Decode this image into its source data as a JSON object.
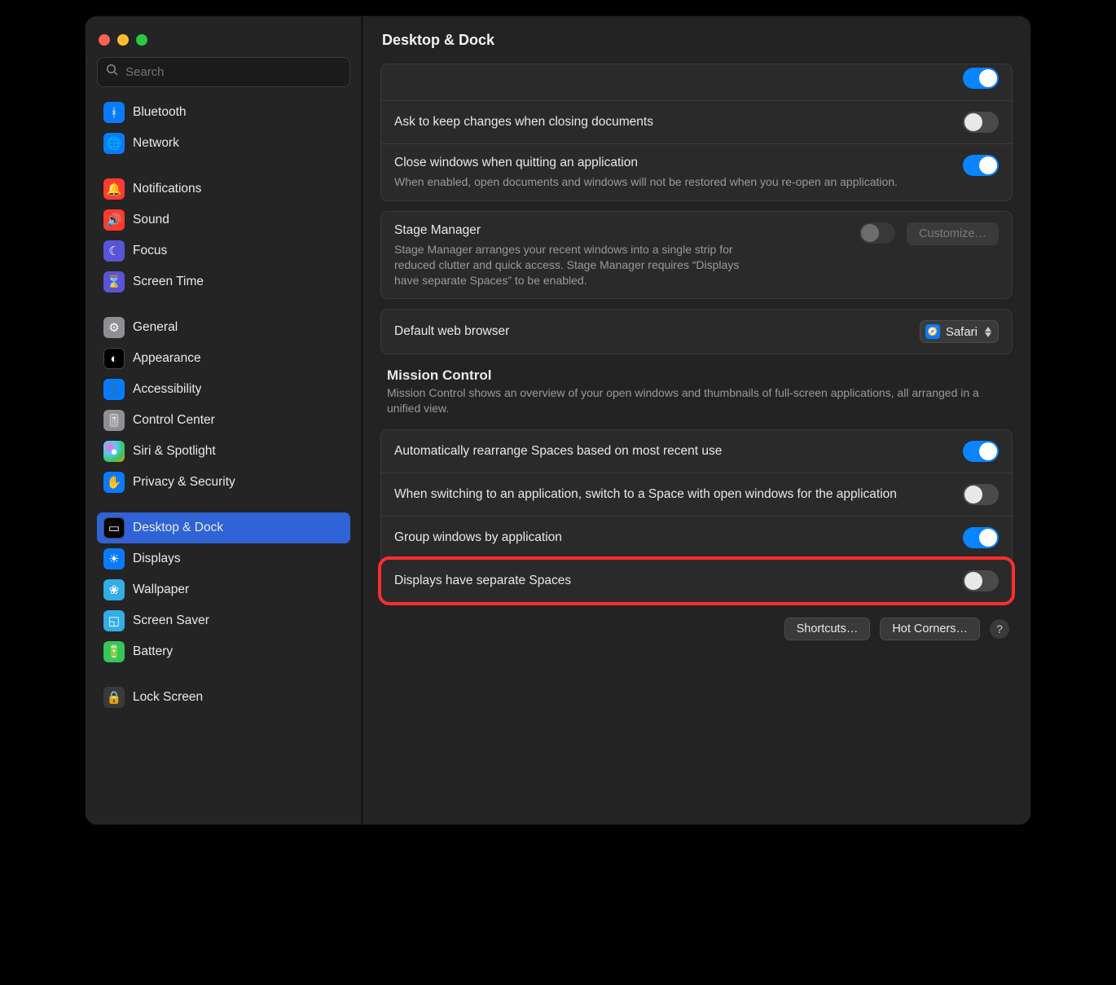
{
  "window": {
    "title": "Desktop & Dock"
  },
  "search": {
    "placeholder": "Search"
  },
  "sidebar": {
    "groups": [
      {
        "items": [
          {
            "label": "Bluetooth",
            "icon": "bluetooth",
            "bg": "bg-blue"
          },
          {
            "label": "Network",
            "icon": "globe",
            "bg": "bg-blue"
          }
        ]
      },
      {
        "items": [
          {
            "label": "Notifications",
            "icon": "bell",
            "bg": "bg-red"
          },
          {
            "label": "Sound",
            "icon": "speaker",
            "bg": "bg-red"
          },
          {
            "label": "Focus",
            "icon": "moon",
            "bg": "bg-purple"
          },
          {
            "label": "Screen Time",
            "icon": "hourglass",
            "bg": "bg-purple"
          }
        ]
      },
      {
        "items": [
          {
            "label": "General",
            "icon": "gear",
            "bg": "bg-gray"
          },
          {
            "label": "Appearance",
            "icon": "contrast",
            "bg": "bg-black"
          },
          {
            "label": "Accessibility",
            "icon": "person",
            "bg": "bg-blue"
          },
          {
            "label": "Control Center",
            "icon": "switches",
            "bg": "bg-gray"
          },
          {
            "label": "Siri & Spotlight",
            "icon": "siri",
            "bg": "bg-siri"
          },
          {
            "label": "Privacy & Security",
            "icon": "hand",
            "bg": "bg-blue"
          }
        ]
      },
      {
        "items": [
          {
            "label": "Desktop & Dock",
            "icon": "dock",
            "bg": "bg-black",
            "selected": true
          },
          {
            "label": "Displays",
            "icon": "brightness",
            "bg": "bg-blue"
          },
          {
            "label": "Wallpaper",
            "icon": "flower",
            "bg": "bg-cyan"
          },
          {
            "label": "Screen Saver",
            "icon": "screensaver",
            "bg": "bg-cyan"
          },
          {
            "label": "Battery",
            "icon": "battery",
            "bg": "bg-green"
          }
        ]
      },
      {
        "items": [
          {
            "label": "Lock Screen",
            "icon": "lock",
            "bg": "bg-darkgray"
          }
        ]
      }
    ]
  },
  "settings": {
    "askKeepChanges": {
      "label": "Ask to keep changes when closing documents",
      "on": false
    },
    "closeWindows": {
      "label": "Close windows when quitting an application",
      "desc": "When enabled, open documents and windows will not be restored when you re-open an application.",
      "on": true
    },
    "stageManager": {
      "label": "Stage Manager",
      "desc": "Stage Manager arranges your recent windows into a single strip for reduced clutter and quick access. Stage Manager requires “Displays have separate Spaces” to be enabled.",
      "on": false,
      "disabled": true,
      "button": "Customize…"
    },
    "defaultBrowser": {
      "label": "Default web browser",
      "value": "Safari"
    },
    "missionControl": {
      "title": "Mission Control",
      "desc": "Mission Control shows an overview of your open windows and thumbnails of full-screen applications, all arranged in a unified view."
    },
    "autoRearrange": {
      "label": "Automatically rearrange Spaces based on most recent use",
      "on": true
    },
    "switchToSpace": {
      "label": "When switching to an application, switch to a Space with open windows for the application",
      "on": false
    },
    "groupWindows": {
      "label": "Group windows by application",
      "on": true
    },
    "separateSpaces": {
      "label": "Displays have separate Spaces",
      "on": false
    }
  },
  "footer": {
    "shortcuts": "Shortcuts…",
    "hotcorners": "Hot Corners…"
  }
}
